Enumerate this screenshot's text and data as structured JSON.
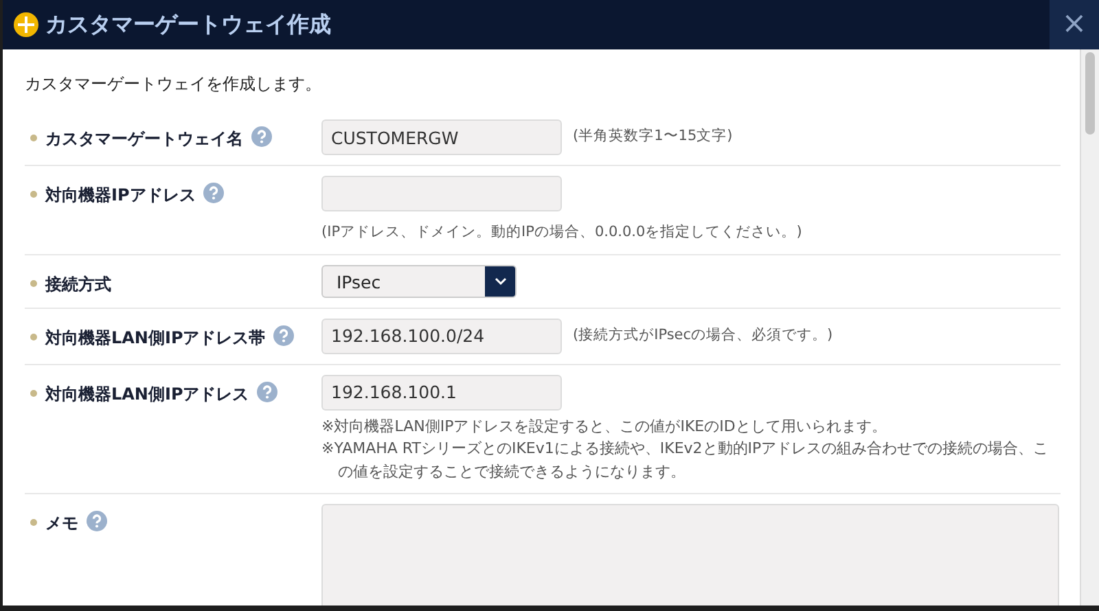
{
  "dialog": {
    "title": "カスタマーゲートウェイ作成",
    "close_label": "×"
  },
  "intro": "カスタマーゲートウェイを作成します。",
  "fields": [
    {
      "kind": "text",
      "label": "カスタマーゲートウェイ名",
      "help": true,
      "value": "CUSTOMERGW",
      "hint": "(半角英数字1〜15文字)",
      "hint_below": false
    },
    {
      "kind": "text",
      "label": "対向機器IPアドレス",
      "help": true,
      "hint": "(IPアドレス、ドメイン。動的IPの場合、0.0.0.0を指定してください。)",
      "hint_below": true
    },
    {
      "kind": "select",
      "label": "接続方式",
      "help": false,
      "value": "IPsec"
    },
    {
      "kind": "text",
      "label": "対向機器LAN側IPアドレス帯",
      "help": true,
      "value": "192.168.100.0/24",
      "hint": "(接続方式がIPsecの場合、必須です。)",
      "hint_below": false
    },
    {
      "kind": "text",
      "label": "対向機器LAN側IPアドレス",
      "help": true,
      "value": "192.168.100.1",
      "notes": [
        "※対向機器LAN側IPアドレスを設定すると、この値がIKEのIDとして用いられます。",
        "※YAMAHA RTシリーズとのIKEv1による接続や、IKEv2と動的IPアドレスの組み合わせでの接続の場合、この値を設定することで接続できるようになります。"
      ]
    },
    {
      "kind": "textarea",
      "label": "メモ",
      "help": true
    }
  ]
}
